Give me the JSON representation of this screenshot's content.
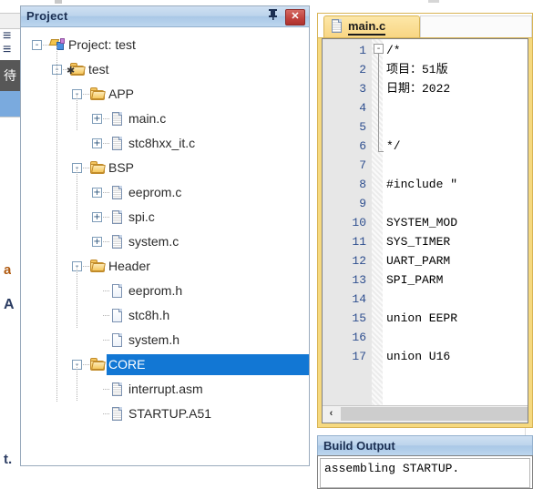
{
  "panels": {
    "project": {
      "title": "Project",
      "pin_icon": "pin-icon",
      "close_label": "✕"
    },
    "build_output": {
      "title": "Build Output",
      "line": "assembling STARTUP."
    }
  },
  "tree": {
    "nodes": [
      {
        "label": "Project: test",
        "depth": 0,
        "toggle": "-",
        "icon": "project-icon",
        "selected": false
      },
      {
        "label": "test",
        "depth": 1,
        "toggle": "-",
        "icon": "target-folder-icon",
        "selected": false
      },
      {
        "label": "APP",
        "depth": 2,
        "toggle": "-",
        "icon": "folder-icon",
        "selected": false
      },
      {
        "label": "main.c",
        "depth": 3,
        "toggle": "+",
        "icon": "c-file-icon",
        "selected": false
      },
      {
        "label": "stc8hxx_it.c",
        "depth": 3,
        "toggle": "+",
        "icon": "c-file-icon",
        "selected": false
      },
      {
        "label": "BSP",
        "depth": 2,
        "toggle": "-",
        "icon": "folder-icon",
        "selected": false
      },
      {
        "label": "eeprom.c",
        "depth": 3,
        "toggle": "+",
        "icon": "c-file-icon",
        "selected": false
      },
      {
        "label": "spi.c",
        "depth": 3,
        "toggle": "+",
        "icon": "c-file-icon",
        "selected": false
      },
      {
        "label": "system.c",
        "depth": 3,
        "toggle": "+",
        "icon": "c-file-icon",
        "selected": false
      },
      {
        "label": "Header",
        "depth": 2,
        "toggle": "-",
        "icon": "folder-icon",
        "selected": false
      },
      {
        "label": "eeprom.h",
        "depth": 3,
        "toggle": "",
        "icon": "h-file-icon",
        "selected": false
      },
      {
        "label": "stc8h.h",
        "depth": 3,
        "toggle": "",
        "icon": "h-file-icon",
        "selected": false
      },
      {
        "label": "system.h",
        "depth": 3,
        "toggle": "",
        "icon": "h-file-icon",
        "selected": false
      },
      {
        "label": "CORE",
        "depth": 2,
        "toggle": "-",
        "icon": "folder-icon",
        "selected": true
      },
      {
        "label": "interrupt.asm",
        "depth": 3,
        "toggle": "",
        "icon": "asm-file-icon",
        "selected": false
      },
      {
        "label": "STARTUP.A51",
        "depth": 3,
        "toggle": "",
        "icon": "asm-file-icon",
        "selected": false
      }
    ]
  },
  "editor": {
    "tab": {
      "label": "main.c",
      "icon": "c-file-icon"
    },
    "fold_toggle": "-",
    "lines": [
      {
        "n": "1",
        "text": "/*",
        "cls": "c-com"
      },
      {
        "n": "2",
        "text": "项目：51版",
        "cls": "c-com"
      },
      {
        "n": "3",
        "text": "日期：2022",
        "cls": "c-com"
      },
      {
        "n": "4",
        "text": "",
        "cls": "c-com"
      },
      {
        "n": "5",
        "text": "",
        "cls": "c-com"
      },
      {
        "n": "6",
        "text": "*/",
        "cls": "c-com"
      },
      {
        "n": "7",
        "text": "",
        "cls": ""
      },
      {
        "n": "8",
        "text": "#include \"",
        "cls": "c-pre"
      },
      {
        "n": "9",
        "text": "",
        "cls": ""
      },
      {
        "n": "10",
        "text": "SYSTEM_MOD",
        "cls": ""
      },
      {
        "n": "11",
        "text": "SYS_TIMER",
        "cls": ""
      },
      {
        "n": "12",
        "text": "UART_PARM",
        "cls": ""
      },
      {
        "n": "13",
        "text": "SPI_PARM",
        "cls": ""
      },
      {
        "n": "14",
        "text": "",
        "cls": ""
      },
      {
        "n": "15",
        "text": "union EEPR",
        "cls": "c-key"
      },
      {
        "n": "16",
        "text": "",
        "cls": ""
      },
      {
        "n": "17",
        "text": "union U16",
        "cls": "c-key"
      }
    ],
    "hscroll": {
      "left_arrow": "‹"
    }
  },
  "background_fragments": {
    "tooltip_char": "待",
    "glyph_a": "a",
    "glyph_A": "A",
    "glyph_t": "t."
  }
}
